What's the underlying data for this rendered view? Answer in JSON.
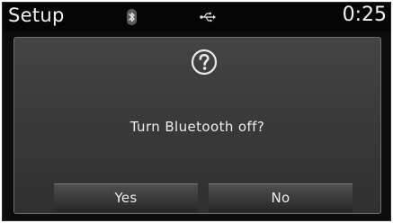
{
  "status_bar": {
    "title": "Setup",
    "time": "0:25",
    "icons": [
      "bluetooth-icon",
      "usb-icon"
    ]
  },
  "dialog": {
    "icon": "question-mark-icon",
    "message": "Turn Bluetooth off?",
    "buttons": {
      "yes_label": "Yes",
      "no_label": "No"
    }
  },
  "colors": {
    "background": "#0c0c0c",
    "text": "#eeeeee",
    "dialog": "#3a3a3a"
  }
}
